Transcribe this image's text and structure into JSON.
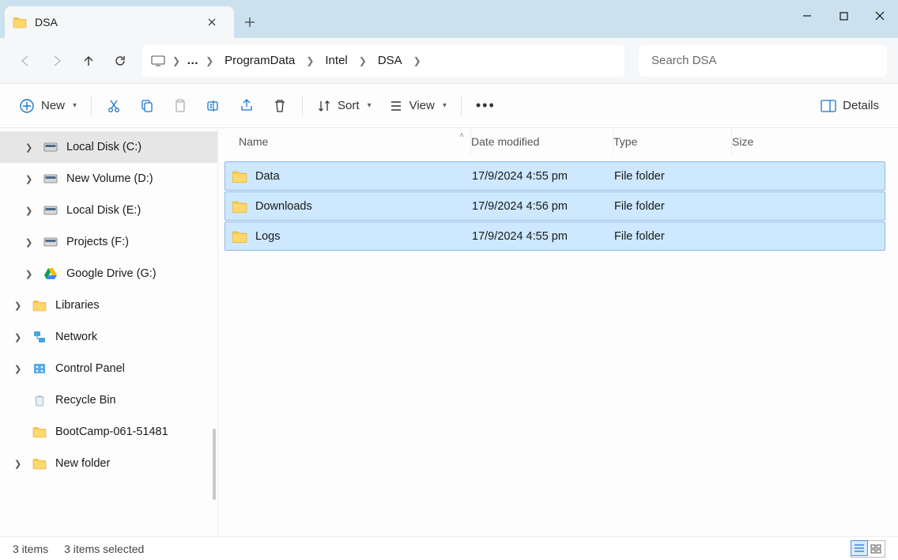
{
  "tab": {
    "title": "DSA"
  },
  "breadcrumbs": [
    "ProgramData",
    "Intel",
    "DSA"
  ],
  "dots_label": "…",
  "search": {
    "placeholder": "Search DSA"
  },
  "toolbar": {
    "new": "New",
    "sort": "Sort",
    "view": "View",
    "details": "Details"
  },
  "columns": {
    "name": "Name",
    "date": "Date modified",
    "type": "Type",
    "size": "Size"
  },
  "rows": [
    {
      "name": "Data",
      "date": "17/9/2024 4:55 pm",
      "type": "File folder",
      "size": ""
    },
    {
      "name": "Downloads",
      "date": "17/9/2024 4:56 pm",
      "type": "File folder",
      "size": ""
    },
    {
      "name": "Logs",
      "date": "17/9/2024 4:55 pm",
      "type": "File folder",
      "size": ""
    }
  ],
  "sidebar": [
    {
      "label": "Local Disk (C:)",
      "icon": "disk",
      "indent": true,
      "expand": true,
      "active": true
    },
    {
      "label": "New Volume (D:)",
      "icon": "disk",
      "indent": true,
      "expand": true,
      "active": false
    },
    {
      "label": "Local Disk (E:)",
      "icon": "disk",
      "indent": true,
      "expand": true,
      "active": false
    },
    {
      "label": "Projects (F:)",
      "icon": "disk",
      "indent": true,
      "expand": true,
      "active": false
    },
    {
      "label": "Google Drive (G:)",
      "icon": "gdrive",
      "indent": true,
      "expand": true,
      "active": false
    },
    {
      "label": "Libraries",
      "icon": "folder",
      "indent": false,
      "expand": true,
      "active": false
    },
    {
      "label": "Network",
      "icon": "network",
      "indent": false,
      "expand": true,
      "active": false
    },
    {
      "label": "Control Panel",
      "icon": "cpanel",
      "indent": false,
      "expand": true,
      "active": false
    },
    {
      "label": "Recycle Bin",
      "icon": "recycle",
      "indent": false,
      "expand": false,
      "active": false
    },
    {
      "label": "BootCamp-061-51481",
      "icon": "folder",
      "indent": false,
      "expand": false,
      "active": false
    },
    {
      "label": "New folder",
      "icon": "folder",
      "indent": false,
      "expand": true,
      "active": false
    }
  ],
  "status": {
    "count": "3 items",
    "selected": "3 items selected"
  }
}
